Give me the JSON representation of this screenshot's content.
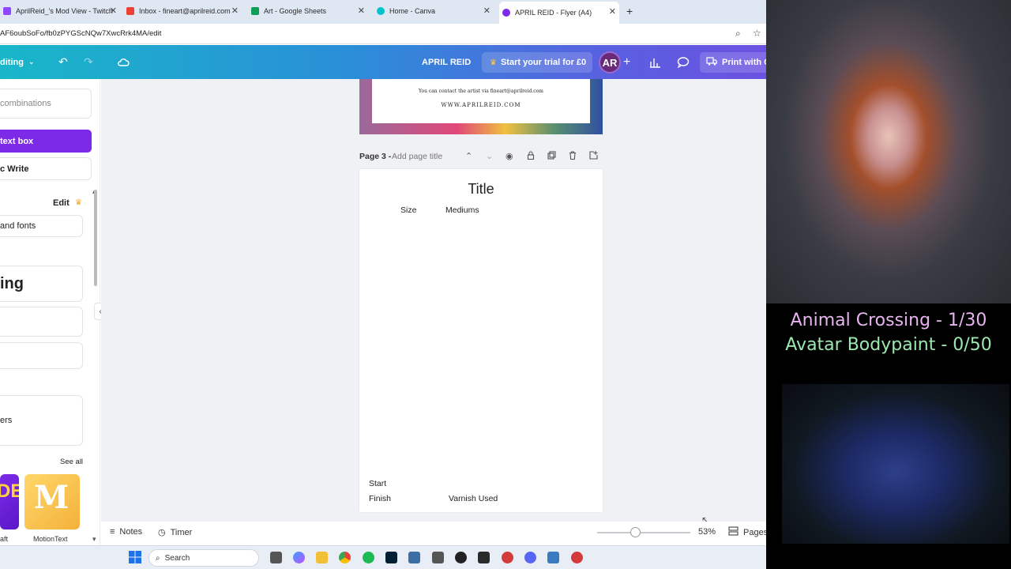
{
  "tabs": [
    {
      "label": "AprilReid_'s Mod View - Twitch",
      "icon": "twitch-icon",
      "color": "#9146ff"
    },
    {
      "label": "Inbox - fineart@aprilreid.com",
      "icon": "gmail-icon",
      "color": "#ea4335"
    },
    {
      "label": "Art - Google Sheets",
      "icon": "sheets-icon",
      "color": "#0f9d58"
    },
    {
      "label": "Home - Canva",
      "icon": "canva-icon",
      "color": "#00c4cc"
    },
    {
      "label": "APRIL REID - Flyer (A4)",
      "icon": "canva-icon",
      "color": "#7d2ae8"
    }
  ],
  "address": {
    "url": "AF6oubSoFo/fb0zPYGScNQw7XwcRrk4MA/edit"
  },
  "canva_bar": {
    "editing_label": "diting",
    "brand_name": "APRIL REID",
    "trial_label": "Start your trial for £0",
    "avatar_initials": "AR",
    "print_label": "Print with C"
  },
  "left_panel": {
    "combinations": "combinations",
    "add_text_box": "text box",
    "magic_write": "c Write",
    "edit_label": "Edit",
    "brand_fonts": "and fonts",
    "heading_sample": "ing",
    "stickers": "ers",
    "see_all": "See all",
    "thumb_right_label": "MotionText",
    "thumb_left_label": "aft"
  },
  "previous_page": {
    "contact_line": "You can contact the artist via fineart@aprilreid.com",
    "website": "WWW.APRILREID.COM"
  },
  "page_header": {
    "page_label": "Page 3 -",
    "page_title_placeholder": "Add page title"
  },
  "page3": {
    "title": "Title",
    "size_label": "Size",
    "mediums_label": "Mediums",
    "start_label": "Start",
    "finish_label": "Finish",
    "varnish_label": "Varnish Used"
  },
  "footer": {
    "notes": "Notes",
    "timer": "Timer",
    "zoom": "53%",
    "pages": "Pages"
  },
  "taskbar": {
    "search": "Search"
  },
  "overlay": {
    "counter1": "Animal Crossing - 1/30",
    "counter2": "Avatar Bodypaint - 0/50",
    "counter1_color": "#e8b4f0",
    "counter2_color": "#9be8b0"
  }
}
